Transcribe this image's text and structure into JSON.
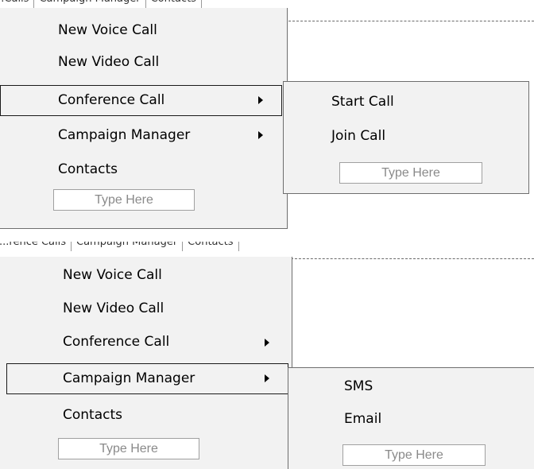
{
  "tab_strip_top": {
    "tabs": [
      "...Calls",
      "Campaign Manager",
      "Contacts"
    ]
  },
  "tab_strip_bottom": {
    "tabs": [
      "...rence Calls",
      "Campaign Manager",
      "Contacts"
    ]
  },
  "menu": {
    "items": [
      {
        "label": "New Voice Call"
      },
      {
        "label": "New Video Call"
      },
      {
        "label": "Conference Call"
      },
      {
        "label": "Campaign Manager"
      },
      {
        "label": "Contacts"
      }
    ],
    "type_here": "Type Here"
  },
  "conference_submenu": {
    "items": [
      {
        "label": "Start Call"
      },
      {
        "label": "Join Call"
      }
    ],
    "type_here": "Type Here"
  },
  "campaign_submenu": {
    "items": [
      {
        "label": "SMS"
      },
      {
        "label": "Email"
      }
    ],
    "type_here": "Type Here"
  }
}
